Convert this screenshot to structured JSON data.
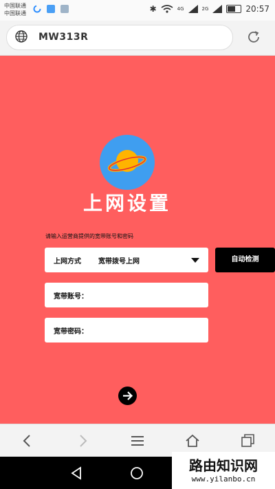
{
  "status_bar": {
    "carrier_line1": "中国联通",
    "carrier_line2": "中国联通",
    "net_label_1": "4G",
    "net_label_2": "2G",
    "time": "20:57"
  },
  "browser": {
    "url": "MW313R"
  },
  "setup": {
    "title": "上网设置",
    "hint": "请输入运营商提供的宽带账号和密码",
    "connection_type_label": "上网方式",
    "connection_type_value": "宽带拨号上网",
    "auto_detect_label": "自动检测",
    "account_label": "宽带账号：",
    "password_label": "宽带密码："
  },
  "watermark": {
    "title": "路由知识网",
    "url": "www.yilanbo.cn"
  },
  "colors": {
    "background": "#ff5e5e",
    "logo_circle": "#3f9ef0",
    "planet": "#ffb400"
  }
}
